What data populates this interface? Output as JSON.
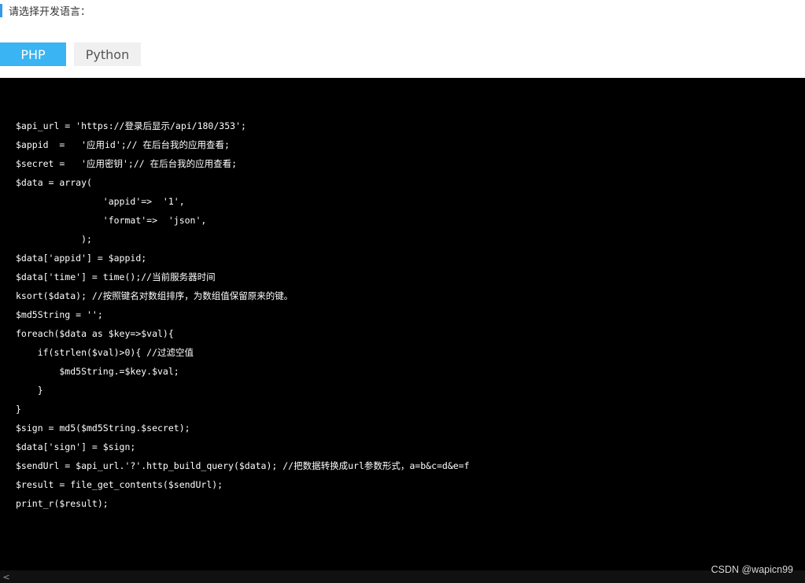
{
  "heading": {
    "text": "请选择开发语言："
  },
  "tabs": [
    {
      "label": "PHP",
      "active": true
    },
    {
      "label": "Python",
      "active": false
    }
  ],
  "code": {
    "lines": [
      "$api_url = 'https://登录后显示/api/180/353';",
      "$appid  =   '应用id';// 在后台我的应用查看;",
      "$secret =   '应用密钥';// 在后台我的应用查看;",
      "$data = array(",
      "                'appid'=>  '1',",
      "                'format'=>  'json',",
      "            );",
      "$data['appid'] = $appid;",
      "$data['time'] = time();//当前服务器时间",
      "ksort($data); //按照键名对数组排序，为数组值保留原来的键。",
      "$md5String = '';",
      "foreach($data as $key=>$val){",
      "    if(strlen($val)>0){ //过滤空值",
      "        $md5String.=$key.$val;",
      "    }",
      "}",
      "$sign = md5($md5String.$secret);",
      "$data['sign'] = $sign;",
      "$sendUrl = $api_url.'?'.http_build_query($data); //把数据转换成url参数形式，a=b&c=d&e=f",
      "$result = file_get_contents($sendUrl);",
      "print_r($result);"
    ]
  },
  "watermark": {
    "text": "CSDN @wapicn99"
  },
  "scrollbar": {
    "left_arrow": "<"
  },
  "colors": {
    "accent": "#3ab4f2",
    "heading_bar": "#3399ea",
    "code_background": "#000000",
    "code_text": "#ffffff"
  }
}
